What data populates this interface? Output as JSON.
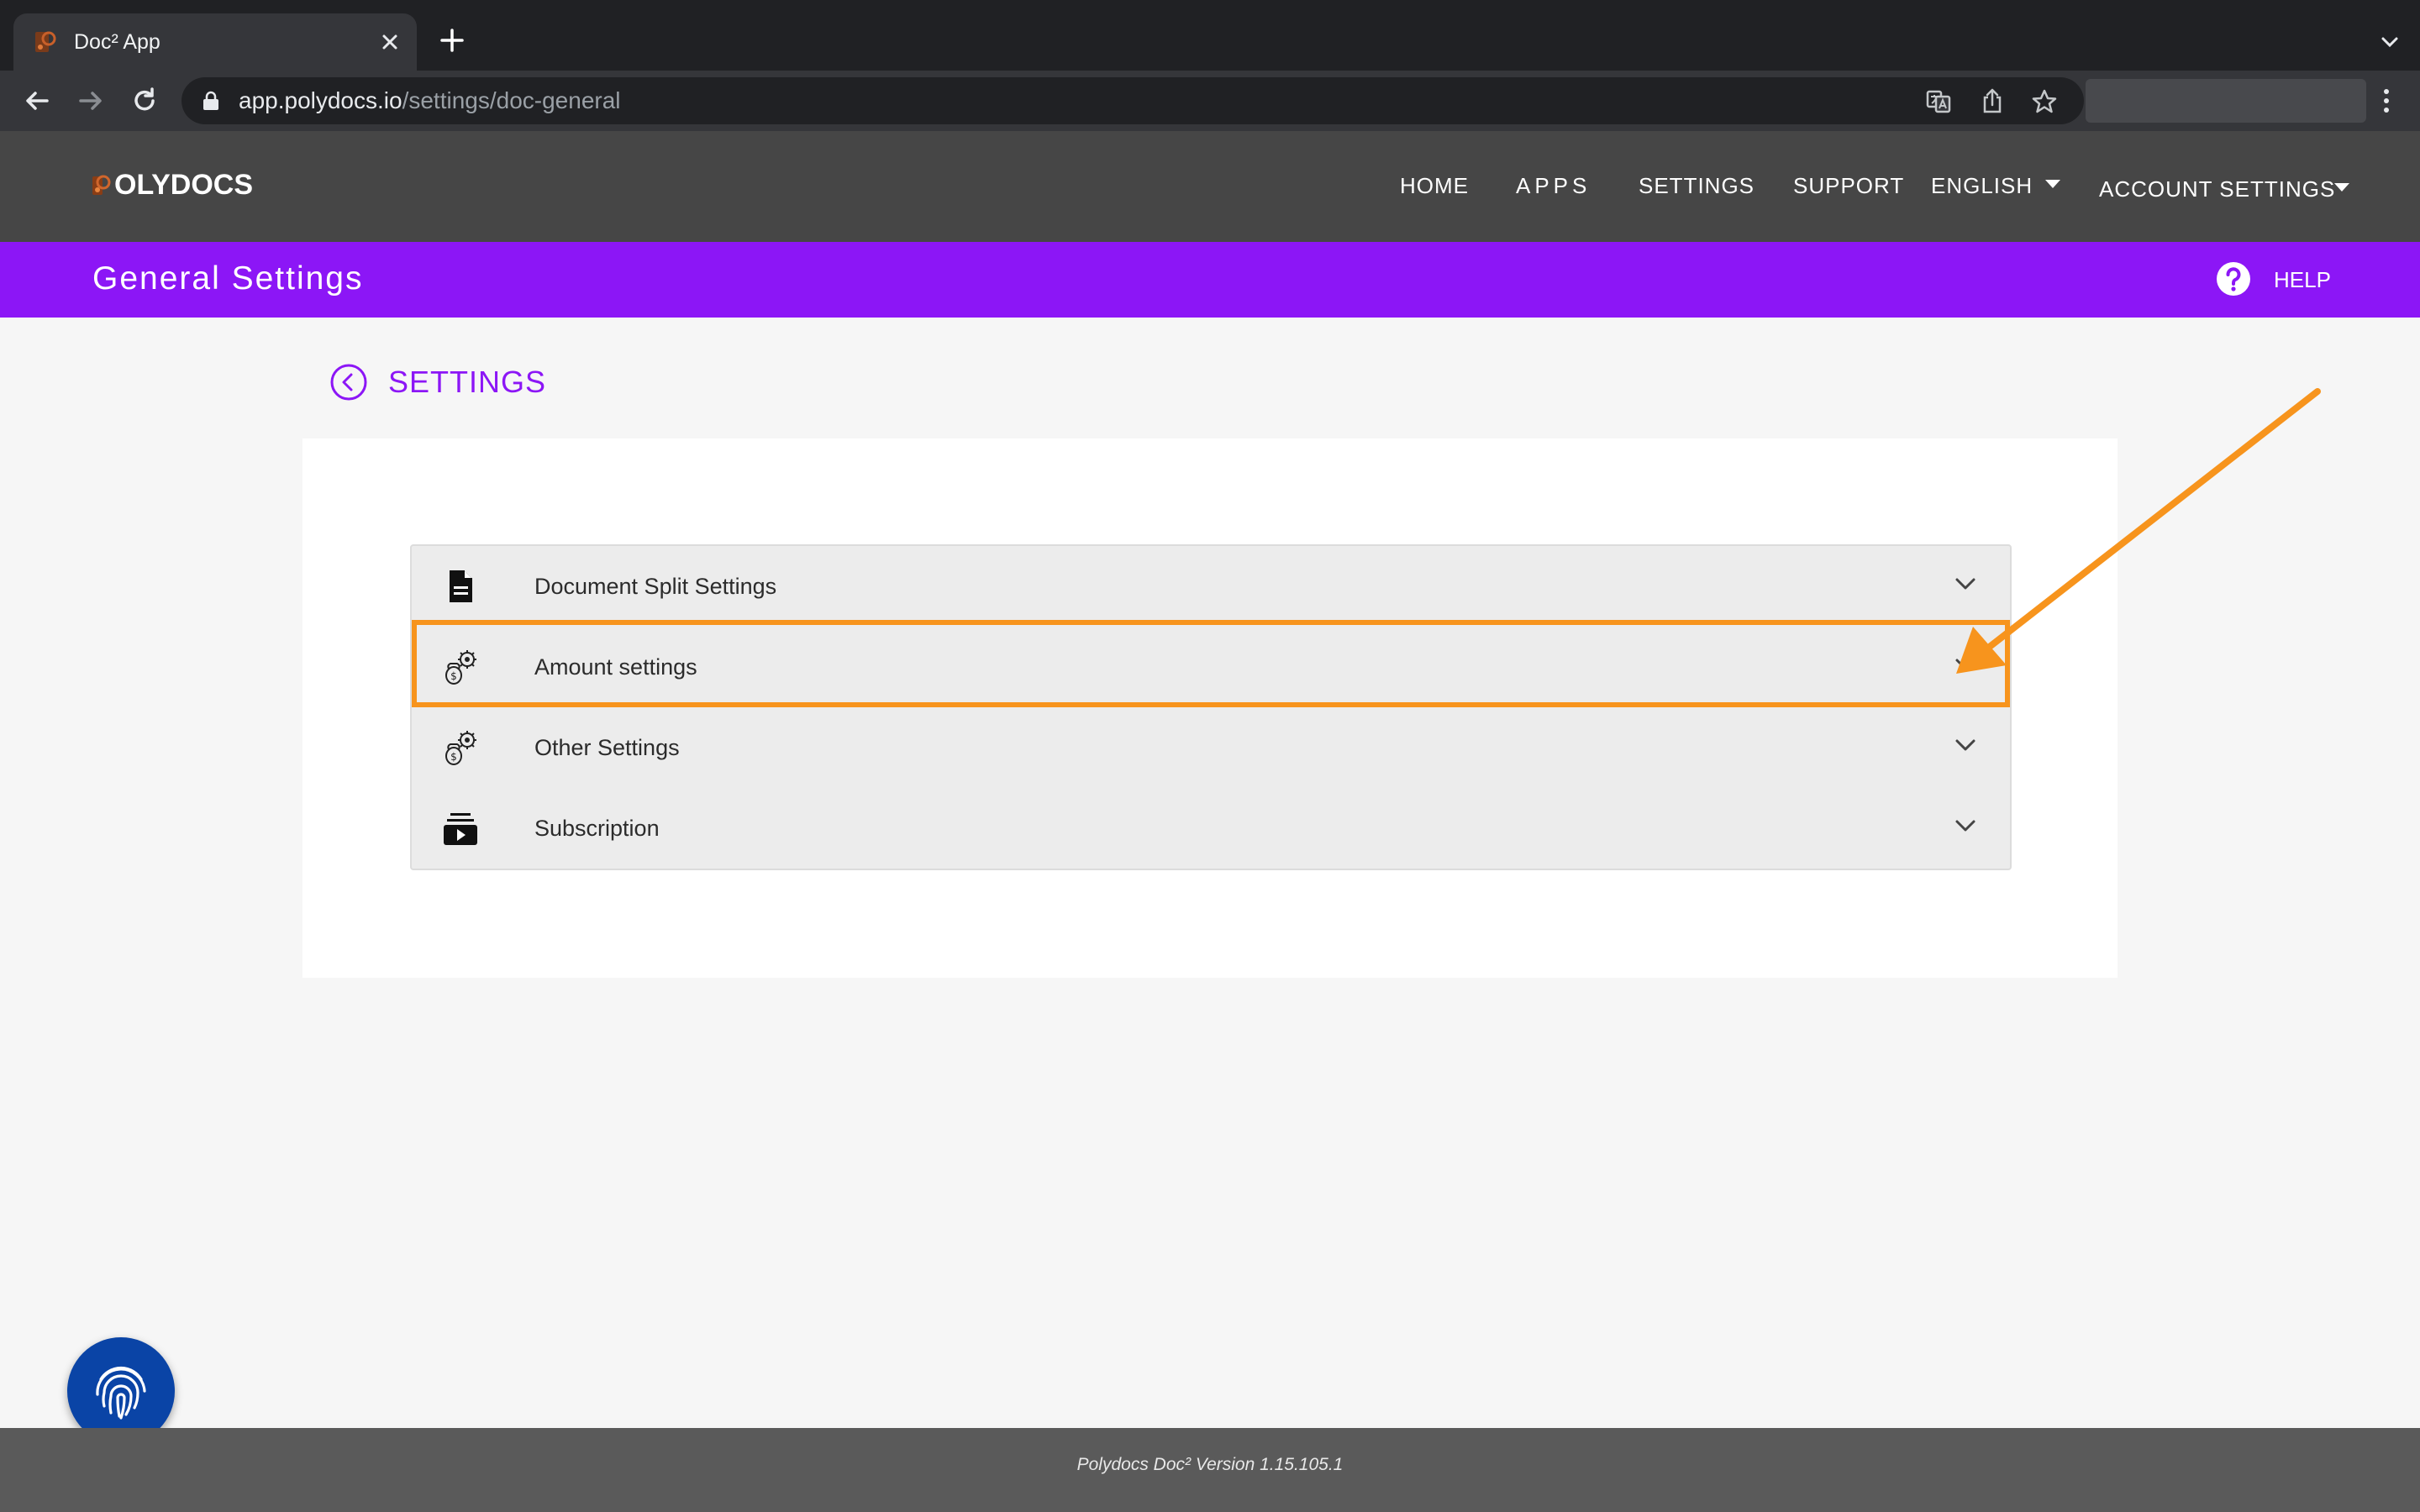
{
  "browser": {
    "tab_title": "Doc² App",
    "url_host": "app.polydocs.io",
    "url_path": "/settings/doc-general"
  },
  "header": {
    "logo_text": "OLYDOCS",
    "nav": {
      "home": "HOME",
      "apps": "APPS",
      "settings": "SETTINGS",
      "support": "SUPPORT",
      "language": "ENGLISH",
      "account": "ACCOUNT SETTINGS"
    }
  },
  "subheader": {
    "title": "General Settings",
    "help_label": "HELP"
  },
  "back_link": {
    "label": "SETTINGS"
  },
  "accordion": {
    "items": [
      {
        "label": "Document Split Settings",
        "icon": "document-icon"
      },
      {
        "label": "Amount settings",
        "icon": "money-settings-icon"
      },
      {
        "label": "Other Settings",
        "icon": "money-settings-icon"
      },
      {
        "label": "Subscription",
        "icon": "subscription-icon"
      }
    ]
  },
  "annotation": {
    "highlight_color": "#f7941d",
    "highlighted_item": "Amount settings"
  },
  "colors": {
    "brand_purple": "#8c16f6",
    "header_gray": "#464646",
    "fab_blue": "#0a44a6"
  },
  "footer": {
    "version_text": "Polydocs Doc² Version 1.15.105.1"
  }
}
